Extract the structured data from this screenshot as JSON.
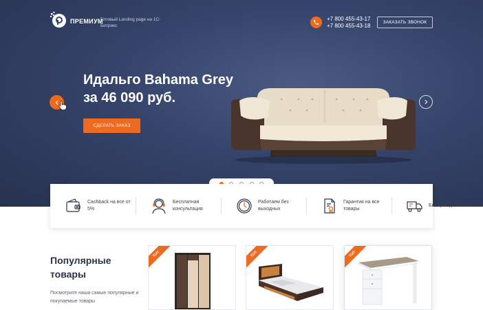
{
  "header": {
    "brand": "ПРЕМИУМ",
    "tagline": "Готовый Landing page на 1С-Битрикс",
    "phones": [
      "+7 800 455-43-17",
      "+7 800 455-43-18"
    ],
    "callback_label": "ЗАКАЗАТЬ ЗВОНОК"
  },
  "slide": {
    "title_line1": "Идальго Bahama Grey",
    "title_line2": "за 46 090 руб.",
    "order_label": "СДЕЛАТЬ ЗАКАЗ",
    "dots_count": 5,
    "active_dot": 1
  },
  "features": [
    {
      "icon": "wallet-icon",
      "text": "Cashback на все от 5%"
    },
    {
      "icon": "headset-icon",
      "text": "Бесплатная консультация"
    },
    {
      "icon": "clock-icon",
      "text": "Работаем без выходных"
    },
    {
      "icon": "certificate-icon",
      "text": "Гарантия на все товары"
    },
    {
      "icon": "truck-icon",
      "text": "Быстрая доставка"
    }
  ],
  "popular": {
    "title": "Популярные товары",
    "description": "Посмотрите наши самые популярные и покупаемые товары"
  },
  "products": [
    {
      "badge": "ТОП",
      "icon": "wardrobe-icon"
    },
    {
      "badge": "ТОП",
      "icon": "bed-icon"
    },
    {
      "badge": "ТОП",
      "icon": "desk-icon"
    }
  ],
  "colors": {
    "accent": "#ee6a1e",
    "hero_bg": "#35436a",
    "text_dark": "#2c3344"
  }
}
